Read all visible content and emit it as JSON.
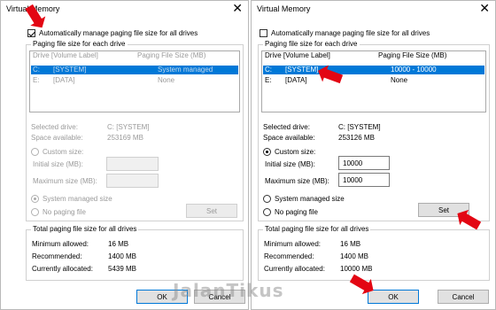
{
  "left": {
    "title": "Virtual Memory",
    "close_glyph": "✕",
    "auto_manage_label": "Automatically manage paging file size for all drives",
    "auto_manage_checked": true,
    "group_title": "Paging file size for each drive",
    "col_drive": "Drive  [Volume Label]",
    "col_size": "Paging File Size (MB)",
    "drives": [
      {
        "drive": "C:",
        "label": "[SYSTEM]",
        "size": "System managed",
        "selected": true
      },
      {
        "drive": "E:",
        "label": "[DATA]",
        "size": "None",
        "selected": false
      }
    ],
    "selected_drive_label": "Selected drive:",
    "selected_drive_value": "C:  [SYSTEM]",
    "space_available_label": "Space available:",
    "space_available_value": "253169 MB",
    "custom_size_label": "Custom size:",
    "initial_size_label": "Initial size (MB):",
    "initial_size_value": "",
    "maximum_size_label": "Maximum size (MB):",
    "maximum_size_value": "",
    "system_managed_label": "System managed size",
    "no_paging_label": "No paging file",
    "set_label": "Set",
    "total_group_title": "Total paging file size for all drives",
    "min_allowed_label": "Minimum allowed:",
    "min_allowed_value": "16 MB",
    "recommended_label": "Recommended:",
    "recommended_value": "1400 MB",
    "allocated_label": "Currently allocated:",
    "allocated_value": "5439 MB",
    "ok_label": "OK",
    "cancel_label": "Cancel"
  },
  "right": {
    "title": "Virtual Memory",
    "close_glyph": "✕",
    "auto_manage_label": "Automatically manage paging file size for all drives",
    "auto_manage_checked": false,
    "group_title": "Paging file size for each drive",
    "col_drive": "Drive  [Volume Label]",
    "col_size": "Paging File Size (MB)",
    "drives": [
      {
        "drive": "C:",
        "label": "[SYSTEM]",
        "size": "10000 - 10000",
        "selected": true
      },
      {
        "drive": "E:",
        "label": "[DATA]",
        "size": "None",
        "selected": false
      }
    ],
    "selected_drive_label": "Selected drive:",
    "selected_drive_value": "C:  [SYSTEM]",
    "space_available_label": "Space available:",
    "space_available_value": "253126 MB",
    "custom_size_label": "Custom size:",
    "initial_size_label": "Initial size (MB):",
    "initial_size_value": "10000",
    "maximum_size_label": "Maximum size (MB):",
    "maximum_size_value": "10000",
    "system_managed_label": "System managed size",
    "no_paging_label": "No paging file",
    "set_label": "Set",
    "total_group_title": "Total paging file size for all drives",
    "min_allowed_label": "Minimum allowed:",
    "min_allowed_value": "16 MB",
    "recommended_label": "Recommended:",
    "recommended_value": "1400 MB",
    "allocated_label": "Currently allocated:",
    "allocated_value": "10000 MB",
    "ok_label": "OK",
    "cancel_label": "Cancel"
  },
  "watermark": "JalanTikus",
  "annotation_color": "#e30613"
}
